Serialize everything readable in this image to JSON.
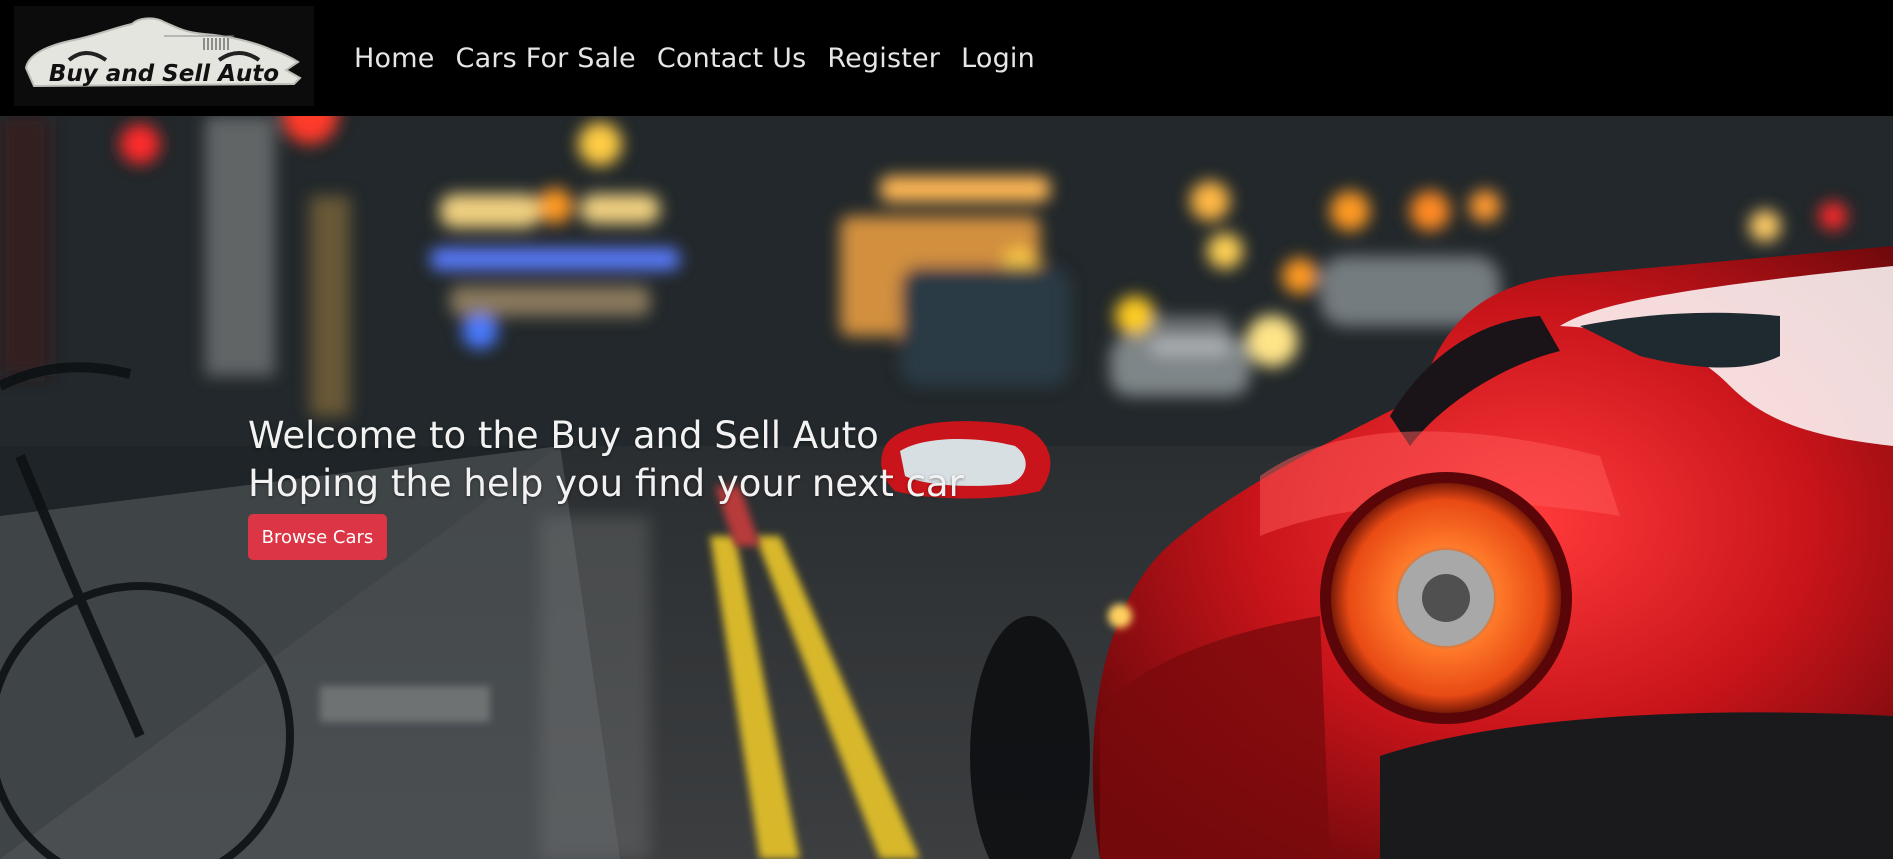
{
  "brand": {
    "logo_text": "Buy and Sell Auto"
  },
  "nav": {
    "items": [
      {
        "label": "Home"
      },
      {
        "label": "Cars For Sale"
      },
      {
        "label": "Contact Us"
      },
      {
        "label": "Register"
      },
      {
        "label": "Login"
      }
    ]
  },
  "hero": {
    "heading_line1": "Welcome to the Buy and Sell Auto",
    "heading_line2": "Hoping the help you find your next car",
    "button_label": "Browse Cars",
    "button_color": "#dc3545"
  }
}
